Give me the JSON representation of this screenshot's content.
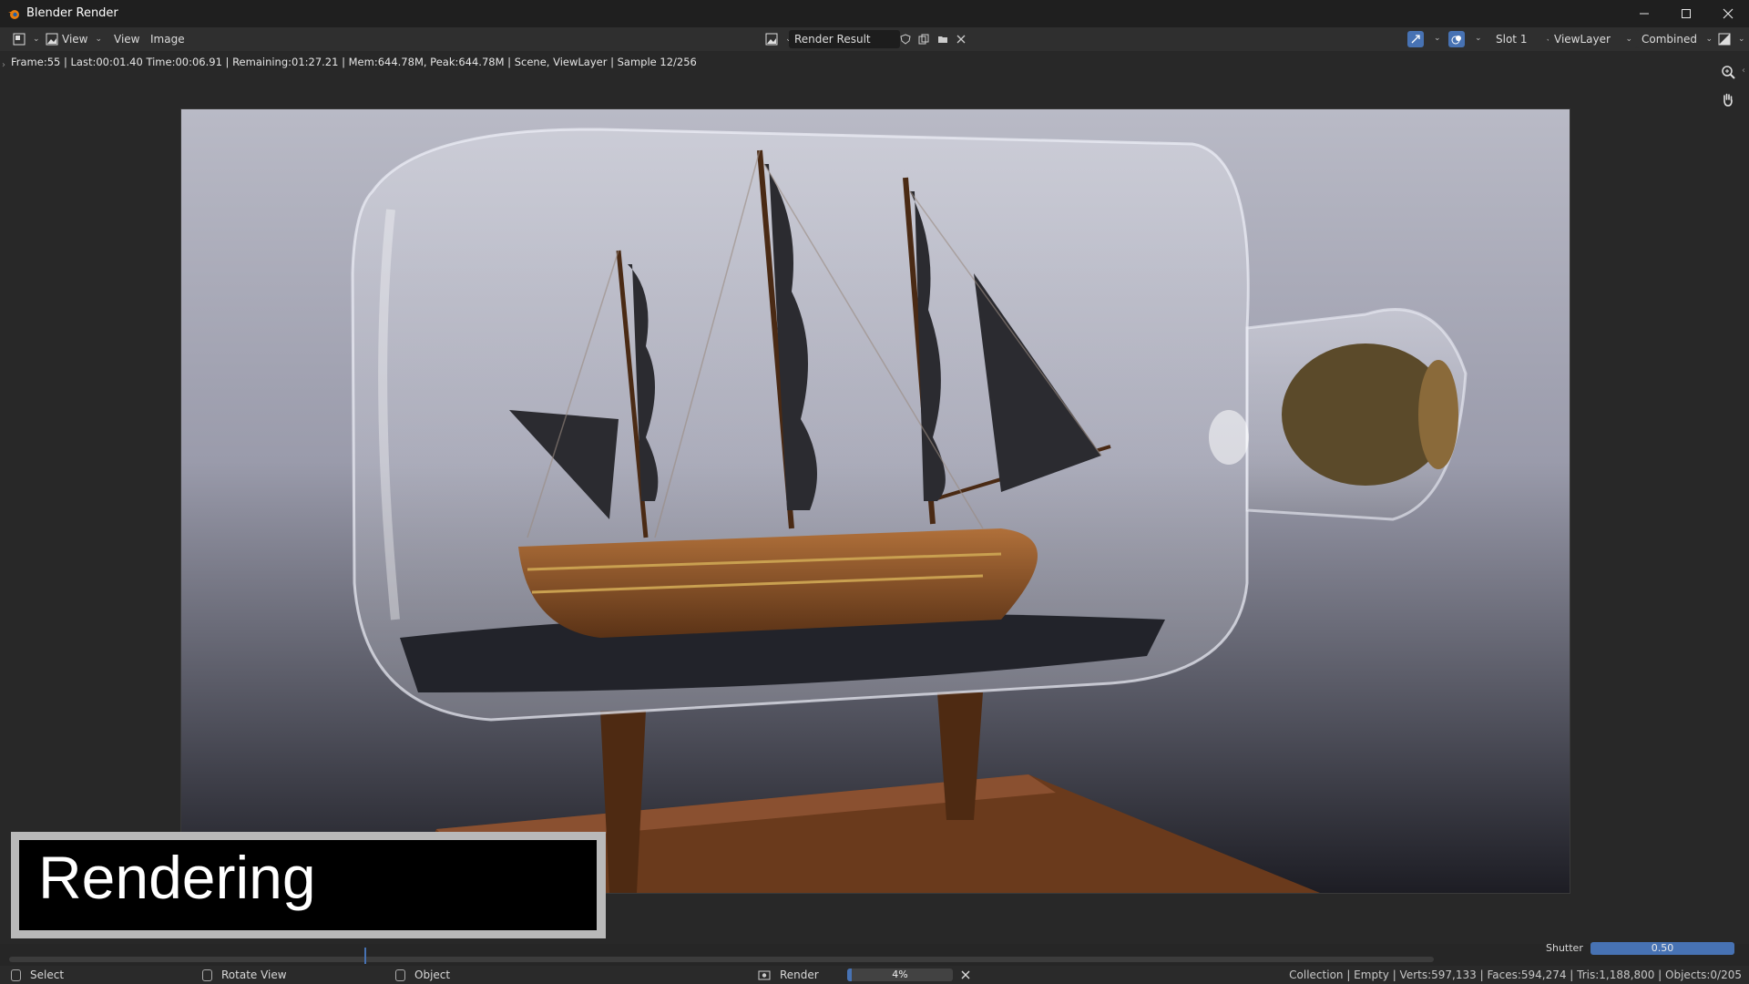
{
  "window": {
    "title": "Blender Render",
    "minimize_icon": "minimize-icon",
    "maximize_icon": "maximize-icon",
    "close_icon": "close-icon"
  },
  "header": {
    "editor_icon": "image-editor-icon",
    "menus": [
      "View",
      "View",
      "Image"
    ],
    "image_name": "Render Result",
    "slot": "Slot 1",
    "view_layer": "ViewLayer",
    "pass": "Combined"
  },
  "status_line": "Frame:55 | Last:00:01.40 Time:00:06.91 | Remaining:01:27.21 | Mem:644.78M, Peak:644.78M | Scene, ViewLayer | Sample 12/256",
  "overlay": {
    "text": "Rendering"
  },
  "shutter": {
    "label": "Shutter",
    "value": "0.50"
  },
  "statusbar": {
    "select": "Select",
    "rotate": "Rotate View",
    "object": "Object",
    "render_label": "Render",
    "progress_percent": 4,
    "progress_text": "4%",
    "stats": "Collection | Empty | Verts:597,133 | Faces:594,274 | Tris:1,188,800 | Objects:0/205"
  },
  "colors": {
    "accent": "#4772b3",
    "background": "#282828",
    "blender_orange": "#e87d0d"
  }
}
